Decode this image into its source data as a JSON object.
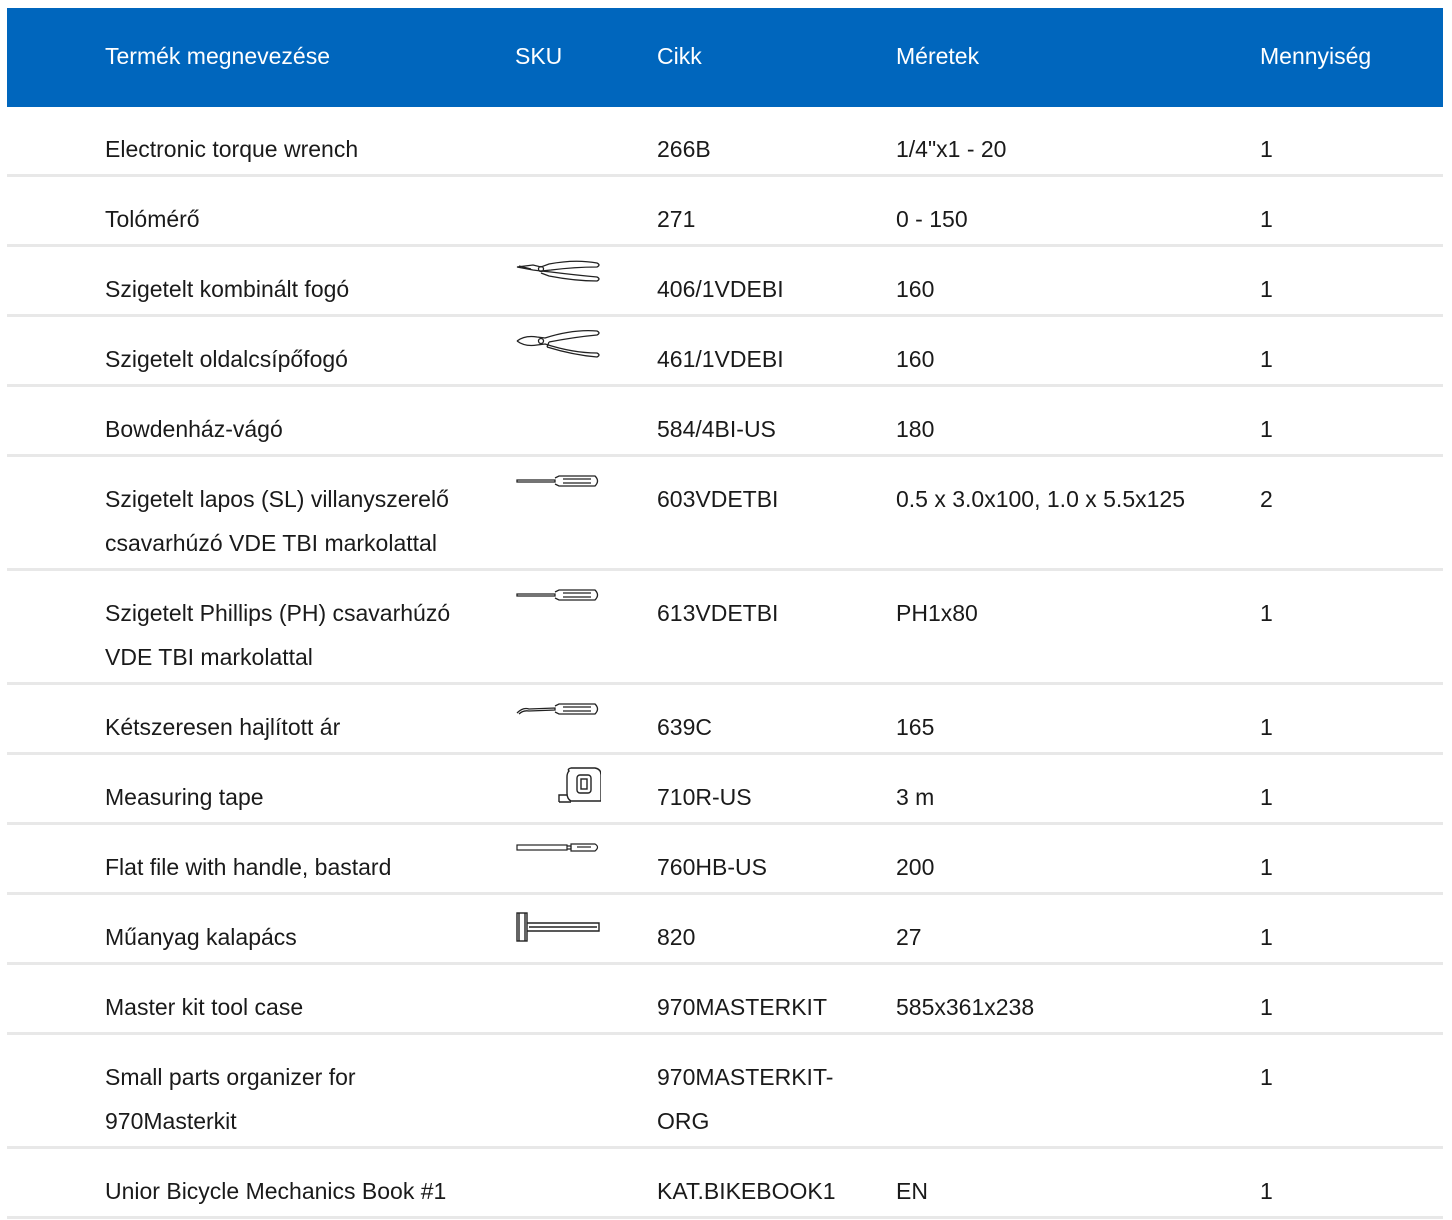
{
  "header": {
    "name": "Termék megnevezése",
    "sku": "SKU",
    "cikk": "Cikk",
    "meretek": "Méretek",
    "mennyiseg": "Mennyiség"
  },
  "rows": [
    {
      "name_lines": [
        "Electronic torque wrench"
      ],
      "cikk_lines": [
        "266B"
      ],
      "meret": "1/4\"x1 - 20",
      "qty": "1",
      "icon": ""
    },
    {
      "name_lines": [
        "Tolómérő"
      ],
      "cikk_lines": [
        "271"
      ],
      "meret": "0 - 150",
      "qty": "1",
      "icon": ""
    },
    {
      "name_lines": [
        "Szigetelt kombinált fogó"
      ],
      "cikk_lines": [
        "406/1VDEBI"
      ],
      "meret": "160",
      "qty": "1",
      "icon": "combination-pliers-icon"
    },
    {
      "name_lines": [
        "Szigetelt oldalcsípőfogó"
      ],
      "cikk_lines": [
        "461/1VDEBI"
      ],
      "meret": "160",
      "qty": "1",
      "icon": "side-cutter-icon"
    },
    {
      "name_lines": [
        "Bowdenház-vágó"
      ],
      "cikk_lines": [
        "584/4BI-US"
      ],
      "meret": "180",
      "qty": "1",
      "icon": ""
    },
    {
      "name_lines": [
        "Szigetelt lapos (SL) villanyszerelő",
        "csavarhúzó VDE TBI markolattal"
      ],
      "cikk_lines": [
        "603VDETBI"
      ],
      "meret": "0.5 x 3.0x100, 1.0 x 5.5x125",
      "qty": "2",
      "icon": "screwdriver-icon"
    },
    {
      "name_lines": [
        "Szigetelt Phillips (PH) csavarhúzó",
        "VDE TBI markolattal"
      ],
      "cikk_lines": [
        "613VDETBI"
      ],
      "meret": "PH1x80",
      "qty": "1",
      "icon": "screwdriver-icon"
    },
    {
      "name_lines": [
        "Kétszeresen hajlított ár"
      ],
      "cikk_lines": [
        "639C"
      ],
      "meret": "165",
      "qty": "1",
      "icon": "bent-awl-icon"
    },
    {
      "name_lines": [
        "Measuring tape"
      ],
      "cikk_lines": [
        "710R-US"
      ],
      "meret": "3 m",
      "qty": "1",
      "icon": "measuring-tape-icon"
    },
    {
      "name_lines": [
        "Flat file with handle, bastard"
      ],
      "cikk_lines": [
        "760HB-US"
      ],
      "meret": "200",
      "qty": "1",
      "icon": "flat-file-icon"
    },
    {
      "name_lines": [
        "Műanyag kalapács"
      ],
      "cikk_lines": [
        "820"
      ],
      "meret": "27",
      "qty": "1",
      "icon": "hammer-icon"
    },
    {
      "name_lines": [
        "Master kit tool case"
      ],
      "cikk_lines": [
        "970MASTERKIT"
      ],
      "meret": "585x361x238",
      "qty": "1",
      "icon": ""
    },
    {
      "name_lines": [
        "Small parts organizer for",
        "970Masterkit"
      ],
      "cikk_lines": [
        "970MASTERKIT-",
        "ORG"
      ],
      "meret": "",
      "qty": "1",
      "icon": ""
    },
    {
      "name_lines": [
        "Unior Bicycle Mechanics Book #1"
      ],
      "cikk_lines": [
        "KAT.BIKEBOOK1"
      ],
      "meret": "EN",
      "qty": "1",
      "icon": ""
    }
  ]
}
